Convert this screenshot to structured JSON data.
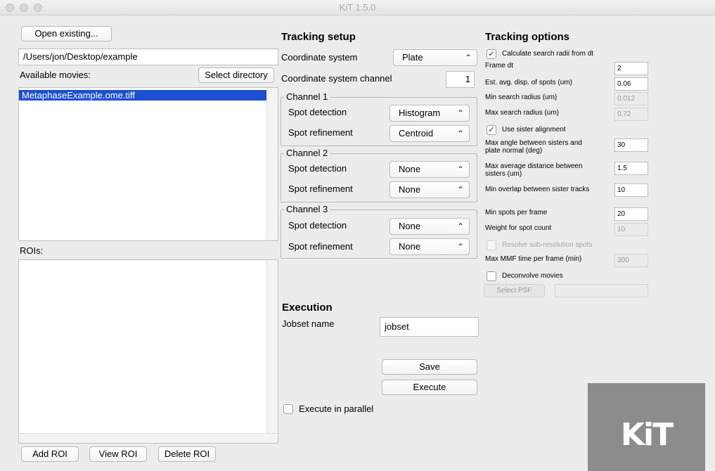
{
  "window": {
    "title": "KiT 1.5.0"
  },
  "left": {
    "open_existing": "Open existing...",
    "path_value": "/Users/jon/Desktop/example",
    "available_movies_label": "Available movies:",
    "select_directory": "Select directory",
    "movies": [
      "MetaphaseExample.ome.tiff"
    ],
    "rois_label": "ROIs:",
    "rois": [],
    "add_roi": "Add ROI",
    "view_roi": "View ROI",
    "delete_roi": "Delete ROI"
  },
  "setup": {
    "title": "Tracking setup",
    "coord_system_label": "Coordinate system",
    "coord_system_value": "Plate",
    "coord_channel_label": "Coordinate system channel",
    "coord_channel_value": "1",
    "channels": [
      {
        "title": "Channel 1",
        "spot_detection_label": "Spot detection",
        "spot_detection": "Histogram",
        "spot_refinement_label": "Spot refinement",
        "spot_refinement": "Centroid"
      },
      {
        "title": "Channel 2",
        "spot_detection_label": "Spot detection",
        "spot_detection": "None",
        "spot_refinement_label": "Spot refinement",
        "spot_refinement": "None"
      },
      {
        "title": "Channel 3",
        "spot_detection_label": "Spot detection",
        "spot_detection": "None",
        "spot_refinement_label": "Spot refinement",
        "spot_refinement": "None"
      }
    ]
  },
  "execution": {
    "title": "Execution",
    "jobset_label": "Jobset name",
    "jobset_value": "jobset",
    "save": "Save",
    "execute": "Execute",
    "parallel_label": "Execute in parallel",
    "parallel_checked": false
  },
  "options": {
    "title": "Tracking options",
    "calc_radii_label": "Calculate search radii from dt",
    "calc_radii_checked": true,
    "frame_dt_label": "Frame dt",
    "frame_dt": "2",
    "est_disp_label": "Est. avg. disp. of spots (um)",
    "est_disp": "0.06",
    "min_radius_label": "Min search radius (um)",
    "min_radius": "0.012",
    "max_radius_label": "Max search radius (um)",
    "max_radius": "0.72",
    "sister_align_label": "Use sister alignment",
    "sister_align_checked": true,
    "max_angle_label_1": "Max angle between sisters and",
    "max_angle_label_2": "plate normal (deg)",
    "max_angle": "30",
    "max_dist_label_1": "Max average distance between",
    "max_dist_label_2": "sisters (um)",
    "max_dist": "1.5",
    "min_overlap_label": "Min overlap between sister tracks",
    "min_overlap": "10",
    "min_spots_label": "Min spots per frame",
    "min_spots": "20",
    "weight_label": "Weight for spot count",
    "weight": "10",
    "resolve_label": "Resolve sub-resolution spots",
    "resolve_checked": false,
    "max_mmf_label": "Max MMF time per frame (min)",
    "max_mmf": "300",
    "deconvolve_label": "Deconvolve movies",
    "deconvolve_checked": false,
    "select_psf": "Select PSF",
    "psf_value": ""
  },
  "logo": {
    "text": "KiT"
  },
  "icons": {
    "check": "✓",
    "chevron": "⌃⌄",
    "updown": "⇕"
  }
}
